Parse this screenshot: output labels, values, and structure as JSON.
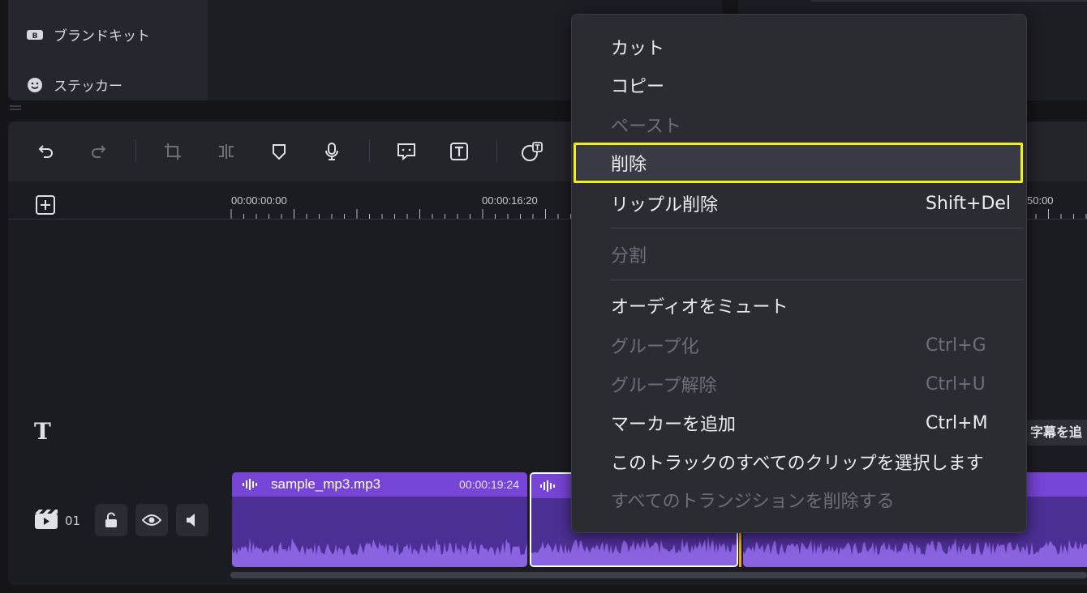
{
  "side_menu": {
    "items": [
      {
        "label": "ブランドキット",
        "icon": "brand-kit-icon"
      },
      {
        "label": "ステッカー",
        "icon": "sticker-icon"
      }
    ]
  },
  "toolbar": {
    "buttons": [
      "undo-icon",
      "redo-icon",
      "crop-icon",
      "split-icon",
      "marker-icon",
      "mic-icon",
      "subtitle-icon",
      "text-icon",
      "speech-to-text-icon"
    ]
  },
  "timeline": {
    "ruler": {
      "tc_0": "00:00:00:00",
      "tc_1": "00:00:16:20",
      "tc_2_partial": "50:00"
    },
    "subtitle_chip": "字幕を追",
    "track": {
      "number": "01"
    },
    "clips": [
      {
        "name": "sample_mp3.mp3",
        "duration": "00:00:19:24"
      }
    ]
  },
  "context_menu": {
    "items": [
      {
        "label": "カット",
        "shortcut": "",
        "enabled": true
      },
      {
        "label": "コピー",
        "shortcut": "",
        "enabled": true
      },
      {
        "label": "ペースト",
        "shortcut": "",
        "enabled": false
      },
      {
        "label": "削除",
        "shortcut": "",
        "enabled": true,
        "highlighted": true
      },
      {
        "label": "リップル削除",
        "shortcut": "Shift+Del",
        "enabled": true
      },
      {
        "label": "分割",
        "shortcut": "",
        "enabled": false
      },
      {
        "label": "オーディオをミュート",
        "shortcut": "",
        "enabled": true
      },
      {
        "label": "グループ化",
        "shortcut": "Ctrl+G",
        "enabled": false
      },
      {
        "label": "グループ解除",
        "shortcut": "Ctrl+U",
        "enabled": false
      },
      {
        "label": "マーカーを追加",
        "shortcut": "Ctrl+M",
        "enabled": true
      },
      {
        "label": "このトラックのすべてのクリップを選択します",
        "shortcut": "",
        "enabled": true
      },
      {
        "label": "すべてのトランジションを削除する",
        "shortcut": "",
        "enabled": false
      }
    ]
  },
  "colors": {
    "highlight_outline": "#f2ef12",
    "clip_header": "#7645d6",
    "clip_body": "#4c2f94",
    "playhead": "#e5a53a"
  }
}
